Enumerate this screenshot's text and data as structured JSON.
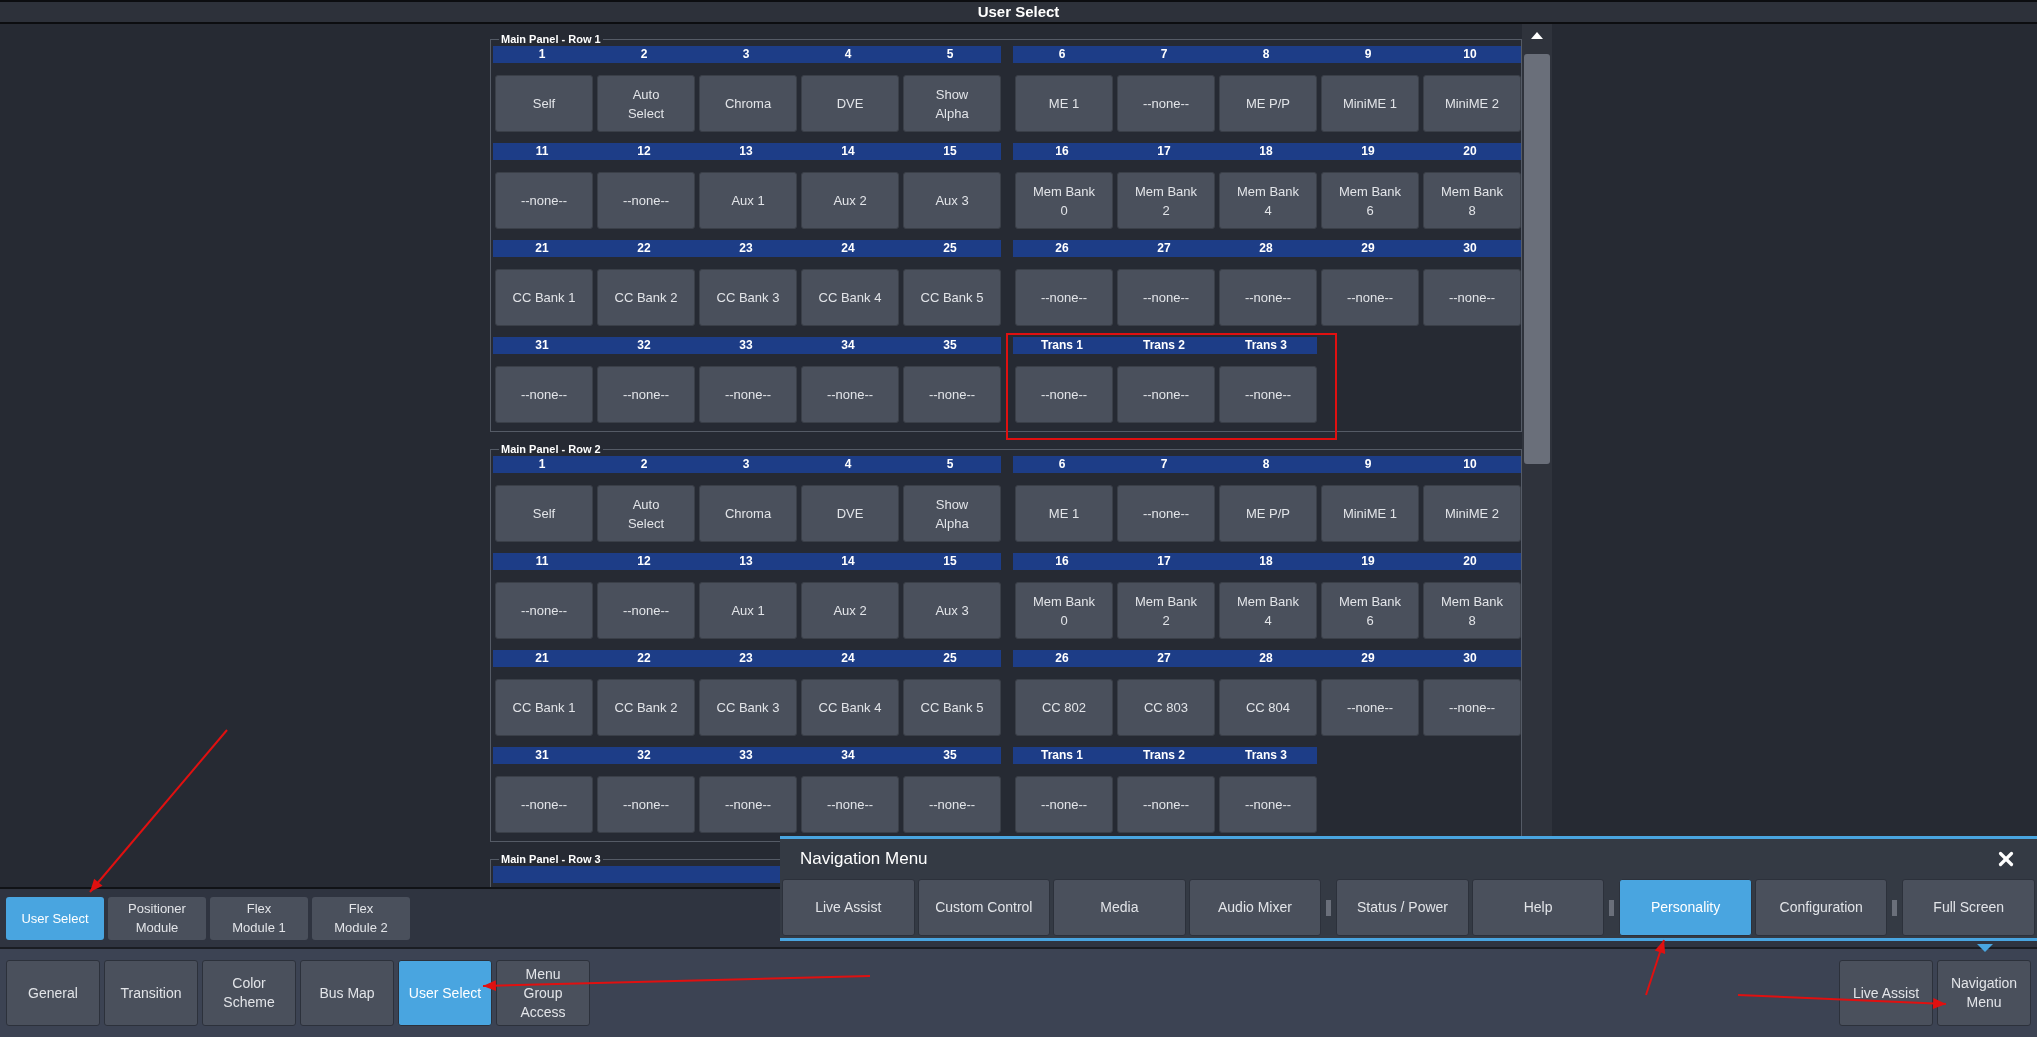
{
  "window": {
    "title": "User Select"
  },
  "panels": [
    {
      "title": "Main Panel - Row 1",
      "blocks": [
        {
          "cells": [
            {
              "n": "1",
              "label": "Self"
            },
            {
              "n": "2",
              "label": "Auto\nSelect"
            },
            {
              "n": "3",
              "label": "Chroma"
            },
            {
              "n": "4",
              "label": "DVE"
            },
            {
              "n": "5",
              "label": "Show\nAlpha"
            },
            {
              "n": "6",
              "label": "ME 1"
            },
            {
              "n": "7",
              "label": "--none--"
            },
            {
              "n": "8",
              "label": "ME P/P"
            },
            {
              "n": "9",
              "label": "MiniME 1"
            },
            {
              "n": "10",
              "label": "MiniME 2"
            }
          ]
        },
        {
          "cells": [
            {
              "n": "11",
              "label": "--none--"
            },
            {
              "n": "12",
              "label": "--none--"
            },
            {
              "n": "13",
              "label": "Aux 1"
            },
            {
              "n": "14",
              "label": "Aux 2"
            },
            {
              "n": "15",
              "label": "Aux 3"
            },
            {
              "n": "16",
              "label": "Mem Bank\n0"
            },
            {
              "n": "17",
              "label": "Mem Bank\n2"
            },
            {
              "n": "18",
              "label": "Mem Bank\n4"
            },
            {
              "n": "19",
              "label": "Mem Bank\n6"
            },
            {
              "n": "20",
              "label": "Mem Bank\n8"
            }
          ]
        },
        {
          "cells": [
            {
              "n": "21",
              "label": "CC Bank 1"
            },
            {
              "n": "22",
              "label": "CC Bank 2"
            },
            {
              "n": "23",
              "label": "CC Bank 3"
            },
            {
              "n": "24",
              "label": "CC Bank 4"
            },
            {
              "n": "25",
              "label": "CC Bank 5"
            },
            {
              "n": "26",
              "label": "--none--"
            },
            {
              "n": "27",
              "label": "--none--"
            },
            {
              "n": "28",
              "label": "--none--"
            },
            {
              "n": "29",
              "label": "--none--"
            },
            {
              "n": "30",
              "label": "--none--"
            }
          ]
        },
        {
          "cells": [
            {
              "n": "31",
              "label": "--none--"
            },
            {
              "n": "32",
              "label": "--none--"
            },
            {
              "n": "33",
              "label": "--none--"
            },
            {
              "n": "34",
              "label": "--none--"
            },
            {
              "n": "35",
              "label": "--none--"
            },
            {
              "n": "Trans 1",
              "label": "--none--"
            },
            {
              "n": "Trans 2",
              "label": "--none--"
            },
            {
              "n": "Trans 3",
              "label": "--none--"
            }
          ]
        }
      ]
    },
    {
      "title": "Main Panel - Row 2",
      "blocks": [
        {
          "cells": [
            {
              "n": "1",
              "label": "Self"
            },
            {
              "n": "2",
              "label": "Auto\nSelect"
            },
            {
              "n": "3",
              "label": "Chroma"
            },
            {
              "n": "4",
              "label": "DVE"
            },
            {
              "n": "5",
              "label": "Show\nAlpha"
            },
            {
              "n": "6",
              "label": "ME 1"
            },
            {
              "n": "7",
              "label": "--none--"
            },
            {
              "n": "8",
              "label": "ME P/P"
            },
            {
              "n": "9",
              "label": "MiniME 1"
            },
            {
              "n": "10",
              "label": "MiniME 2"
            }
          ]
        },
        {
          "cells": [
            {
              "n": "11",
              "label": "--none--"
            },
            {
              "n": "12",
              "label": "--none--"
            },
            {
              "n": "13",
              "label": "Aux 1"
            },
            {
              "n": "14",
              "label": "Aux 2"
            },
            {
              "n": "15",
              "label": "Aux 3"
            },
            {
              "n": "16",
              "label": "Mem Bank\n0"
            },
            {
              "n": "17",
              "label": "Mem Bank\n2"
            },
            {
              "n": "18",
              "label": "Mem Bank\n4"
            },
            {
              "n": "19",
              "label": "Mem Bank\n6"
            },
            {
              "n": "20",
              "label": "Mem Bank\n8"
            }
          ]
        },
        {
          "cells": [
            {
              "n": "21",
              "label": "CC Bank 1"
            },
            {
              "n": "22",
              "label": "CC Bank 2"
            },
            {
              "n": "23",
              "label": "CC Bank 3"
            },
            {
              "n": "24",
              "label": "CC Bank 4"
            },
            {
              "n": "25",
              "label": "CC Bank 5"
            },
            {
              "n": "26",
              "label": "CC 802"
            },
            {
              "n": "27",
              "label": "CC 803"
            },
            {
              "n": "28",
              "label": "CC 804"
            },
            {
              "n": "29",
              "label": "--none--"
            },
            {
              "n": "30",
              "label": "--none--"
            }
          ]
        },
        {
          "cells": [
            {
              "n": "31",
              "label": "--none--"
            },
            {
              "n": "32",
              "label": "--none--"
            },
            {
              "n": "33",
              "label": "--none--"
            },
            {
              "n": "34",
              "label": "--none--"
            },
            {
              "n": "35",
              "label": "--none--"
            },
            {
              "n": "Trans 1",
              "label": "--none--"
            },
            {
              "n": "Trans 2",
              "label": "--none--"
            },
            {
              "n": "Trans 3",
              "label": "--none--"
            }
          ]
        }
      ]
    },
    {
      "title": "Main Panel - Row 3"
    }
  ],
  "module_tabs": [
    {
      "label": "User Select",
      "selected": true
    },
    {
      "label": "Positioner\nModule",
      "selected": false
    },
    {
      "label": "Flex\nModule 1",
      "selected": false
    },
    {
      "label": "Flex\nModule 2",
      "selected": false
    }
  ],
  "navigation_menu": {
    "title": "Navigation Menu",
    "items": [
      {
        "label": "Live Assist",
        "selected": false,
        "separator_before": false
      },
      {
        "label": "Custom Control",
        "selected": false,
        "separator_before": false
      },
      {
        "label": "Media",
        "selected": false,
        "separator_before": false
      },
      {
        "label": "Audio Mixer",
        "selected": false,
        "separator_before": false
      },
      {
        "label": "Status / Power",
        "selected": false,
        "separator_before": true
      },
      {
        "label": "Help",
        "selected": false,
        "separator_before": false
      },
      {
        "label": "Personality",
        "selected": true,
        "separator_before": true
      },
      {
        "label": "Configuration",
        "selected": false,
        "separator_before": false
      },
      {
        "label": "Full Screen",
        "selected": false,
        "separator_before": true
      }
    ]
  },
  "bottom_tabs": [
    {
      "label": "General",
      "selected": false
    },
    {
      "label": "Transition",
      "selected": false
    },
    {
      "label": "Color\nScheme",
      "selected": false
    },
    {
      "label": "Bus Map",
      "selected": false
    },
    {
      "label": "User Select",
      "selected": true
    },
    {
      "label": "Menu\nGroup\nAccess",
      "selected": false
    }
  ],
  "bottom_right_buttons": [
    {
      "label": "Live Assist",
      "expanded": false
    },
    {
      "label": "Navigation\nMenu",
      "expanded": true
    }
  ]
}
